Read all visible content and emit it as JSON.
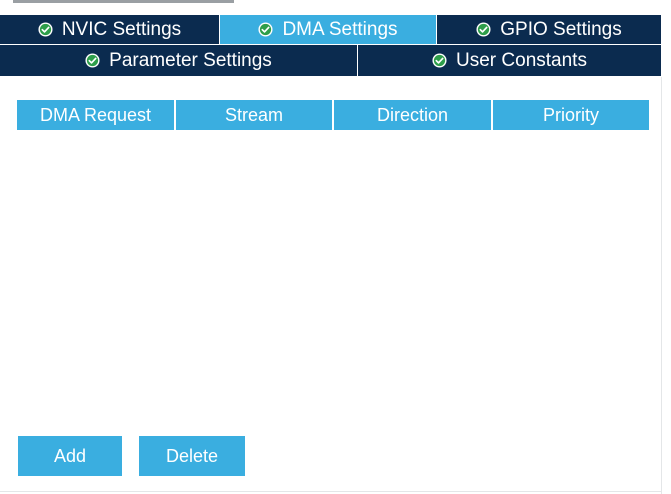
{
  "tabs_row1": [
    {
      "label": "NVIC Settings",
      "icon": "check-circle-icon",
      "active": false
    },
    {
      "label": "DMA Settings",
      "icon": "check-circle-icon",
      "active": true
    },
    {
      "label": "GPIO Settings",
      "icon": "check-circle-icon",
      "active": false
    }
  ],
  "tabs_row2": [
    {
      "label": "Parameter Settings",
      "icon": "check-circle-icon",
      "active": false
    },
    {
      "label": "User Constants",
      "icon": "check-circle-icon",
      "active": false
    }
  ],
  "table": {
    "columns": [
      "DMA Request",
      "Stream",
      "Direction",
      "Priority"
    ],
    "rows": []
  },
  "buttons": {
    "add_label": "Add",
    "delete_label": "Delete"
  },
  "colors": {
    "tab_bg": "#0b2b4f",
    "accent": "#3aaee0",
    "check_green": "#2e9e4a"
  }
}
